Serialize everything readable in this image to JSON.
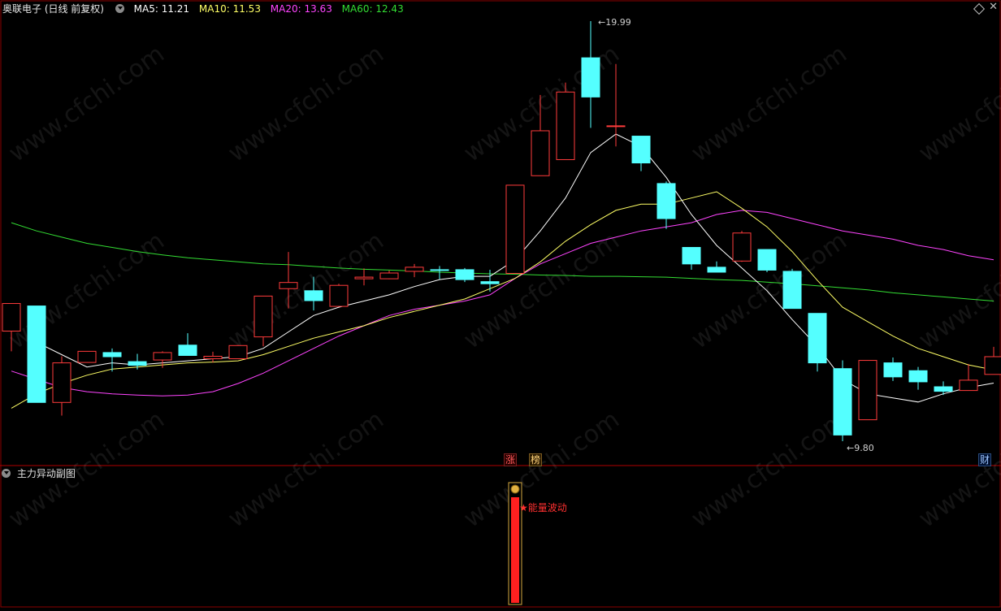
{
  "header": {
    "stock_name": "奥联电子 (日线 前复权)",
    "ma5_label": "MA5: 11.21",
    "ma10_label": "MA10: 11.53",
    "ma20_label": "MA20: 13.63",
    "ma60_label": "MA60: 12.43",
    "ma5_color": "#ffffff",
    "ma10_color": "#ffff66",
    "ma20_color": "#ff44ff",
    "ma60_color": "#33dd33"
  },
  "sub_panel": {
    "title": "主力异动副图",
    "energy_label": "★能量波动",
    "bar_color": "#ff2020"
  },
  "markers": {
    "zhang": "涨",
    "bang": "榜",
    "cai": "财"
  },
  "watermark": "www.cfchi.com",
  "chart_data": {
    "type": "candlestick",
    "price_range": [
      9.8,
      19.99
    ],
    "high_label": "19.99",
    "low_label": "9.80",
    "up_color": "#ff3b3b",
    "down_color": "#54ffff",
    "candles": [
      {
        "o": 12.47,
        "h": 12.92,
        "l": 11.98,
        "c": 13.14
      },
      {
        "o": 13.08,
        "h": 13.08,
        "l": 10.74,
        "c": 10.74
      },
      {
        "o": 10.74,
        "h": 11.86,
        "l": 10.42,
        "c": 11.7
      },
      {
        "o": 11.71,
        "h": 11.97,
        "l": 11.76,
        "c": 11.98
      },
      {
        "o": 11.95,
        "h": 12.05,
        "l": 11.49,
        "c": 11.85
      },
      {
        "o": 11.73,
        "h": 11.92,
        "l": 11.54,
        "c": 11.64
      },
      {
        "o": 11.77,
        "h": 11.98,
        "l": 11.58,
        "c": 11.95
      },
      {
        "o": 12.13,
        "h": 12.42,
        "l": 11.88,
        "c": 11.88
      },
      {
        "o": 11.8,
        "h": 11.97,
        "l": 11.71,
        "c": 11.86
      },
      {
        "o": 11.8,
        "h": 12.13,
        "l": 11.81,
        "c": 12.12
      },
      {
        "o": 12.33,
        "h": 13.09,
        "l": 12.1,
        "c": 13.32
      },
      {
        "o": 13.5,
        "h": 14.39,
        "l": 13.02,
        "c": 13.65
      },
      {
        "o": 13.45,
        "h": 13.79,
        "l": 12.97,
        "c": 13.21
      },
      {
        "o": 13.07,
        "h": 13.62,
        "l": 13.13,
        "c": 13.58
      },
      {
        "o": 13.74,
        "h": 13.99,
        "l": 13.58,
        "c": 13.78
      },
      {
        "o": 13.74,
        "h": 13.94,
        "l": 13.73,
        "c": 13.88
      },
      {
        "o": 13.92,
        "h": 14.1,
        "l": 13.78,
        "c": 14.02
      },
      {
        "o": 13.96,
        "h": 14.05,
        "l": 13.73,
        "c": 13.94
      },
      {
        "o": 13.96,
        "h": 14.0,
        "l": 13.66,
        "c": 13.72
      },
      {
        "o": 13.67,
        "h": 13.96,
        "l": 13.43,
        "c": 13.62
      },
      {
        "o": 13.87,
        "h": 16.01,
        "l": 13.87,
        "c": 16.01
      },
      {
        "o": 16.24,
        "h": 18.2,
        "l": 16.24,
        "c": 17.33
      },
      {
        "o": 16.63,
        "h": 18.5,
        "l": 16.63,
        "c": 18.27
      },
      {
        "o": 19.1,
        "h": 19.99,
        "l": 17.4,
        "c": 18.15
      },
      {
        "o": 17.45,
        "h": 18.95,
        "l": 16.95,
        "c": 17.45
      },
      {
        "o": 17.2,
        "h": 17.2,
        "l": 16.35,
        "c": 16.55
      },
      {
        "o": 16.05,
        "h": 16.1,
        "l": 14.95,
        "c": 15.2
      },
      {
        "o": 14.5,
        "h": 14.5,
        "l": 13.96,
        "c": 14.1
      },
      {
        "o": 14.02,
        "h": 14.16,
        "l": 13.9,
        "c": 13.9
      },
      {
        "o": 14.17,
        "h": 14.9,
        "l": 14.15,
        "c": 14.85
      },
      {
        "o": 14.45,
        "h": 14.45,
        "l": 13.9,
        "c": 13.95
      },
      {
        "o": 13.92,
        "h": 13.98,
        "l": 13.02,
        "c": 13.02
      },
      {
        "o": 12.9,
        "h": 12.9,
        "l": 11.49,
        "c": 11.7
      },
      {
        "o": 11.56,
        "h": 11.76,
        "l": 9.8,
        "c": 9.95
      },
      {
        "o": 10.32,
        "h": 11.74,
        "l": 10.33,
        "c": 11.76
      },
      {
        "o": 11.7,
        "h": 11.83,
        "l": 11.26,
        "c": 11.36
      },
      {
        "o": 11.51,
        "h": 11.6,
        "l": 11.05,
        "c": 11.24
      },
      {
        "o": 11.12,
        "h": 11.25,
        "l": 10.92,
        "c": 11.01
      },
      {
        "o": 11.03,
        "h": 11.67,
        "l": 11.03,
        "c": 11.28
      },
      {
        "o": 11.42,
        "h": 12.09,
        "l": 11.42,
        "c": 11.85
      }
    ],
    "ma5": [
      null,
      12.2,
      11.9,
      11.6,
      11.7,
      11.65,
      11.7,
      11.75,
      11.8,
      11.85,
      12.05,
      12.45,
      12.85,
      13.05,
      13.2,
      13.35,
      13.55,
      13.72,
      13.8,
      13.8,
      14.2,
      14.9,
      15.7,
      16.8,
      17.25,
      16.95,
      16.2,
      15.3,
      14.55,
      14.0,
      13.45,
      12.75,
      12.1,
      11.3,
      10.95,
      10.85,
      10.75,
      10.95,
      11.1,
      11.21
    ],
    "ma10": [
      10.6,
      10.95,
      11.2,
      11.4,
      11.55,
      11.6,
      11.65,
      11.7,
      11.72,
      11.75,
      11.9,
      12.1,
      12.3,
      12.45,
      12.6,
      12.8,
      12.95,
      13.1,
      13.25,
      13.5,
      13.75,
      14.15,
      14.65,
      15.05,
      15.4,
      15.55,
      15.55,
      15.7,
      15.85,
      15.45,
      15.0,
      14.4,
      13.7,
      13.05,
      12.7,
      12.35,
      12.05,
      11.85,
      11.65,
      11.53
    ],
    "ma20": [
      11.5,
      11.3,
      11.1,
      11.0,
      10.95,
      10.92,
      10.9,
      10.92,
      11.0,
      11.2,
      11.45,
      11.75,
      12.05,
      12.35,
      12.6,
      12.85,
      13.0,
      13.1,
      13.2,
      13.35,
      13.75,
      14.1,
      14.35,
      14.6,
      14.75,
      14.9,
      15.0,
      15.1,
      15.3,
      15.4,
      15.35,
      15.2,
      15.05,
      14.9,
      14.8,
      14.7,
      14.55,
      14.45,
      14.3,
      14.2
    ],
    "ma60": [
      15.1,
      14.9,
      14.75,
      14.6,
      14.5,
      14.4,
      14.32,
      14.25,
      14.2,
      14.15,
      14.1,
      14.08,
      14.04,
      14.0,
      13.97,
      13.95,
      13.93,
      13.9,
      13.88,
      13.86,
      13.85,
      13.83,
      13.82,
      13.8,
      13.8,
      13.79,
      13.78,
      13.75,
      13.72,
      13.7,
      13.66,
      13.62,
      13.57,
      13.52,
      13.47,
      13.4,
      13.35,
      13.3,
      13.25,
      13.2
    ],
    "sub_bar_index": 20
  }
}
